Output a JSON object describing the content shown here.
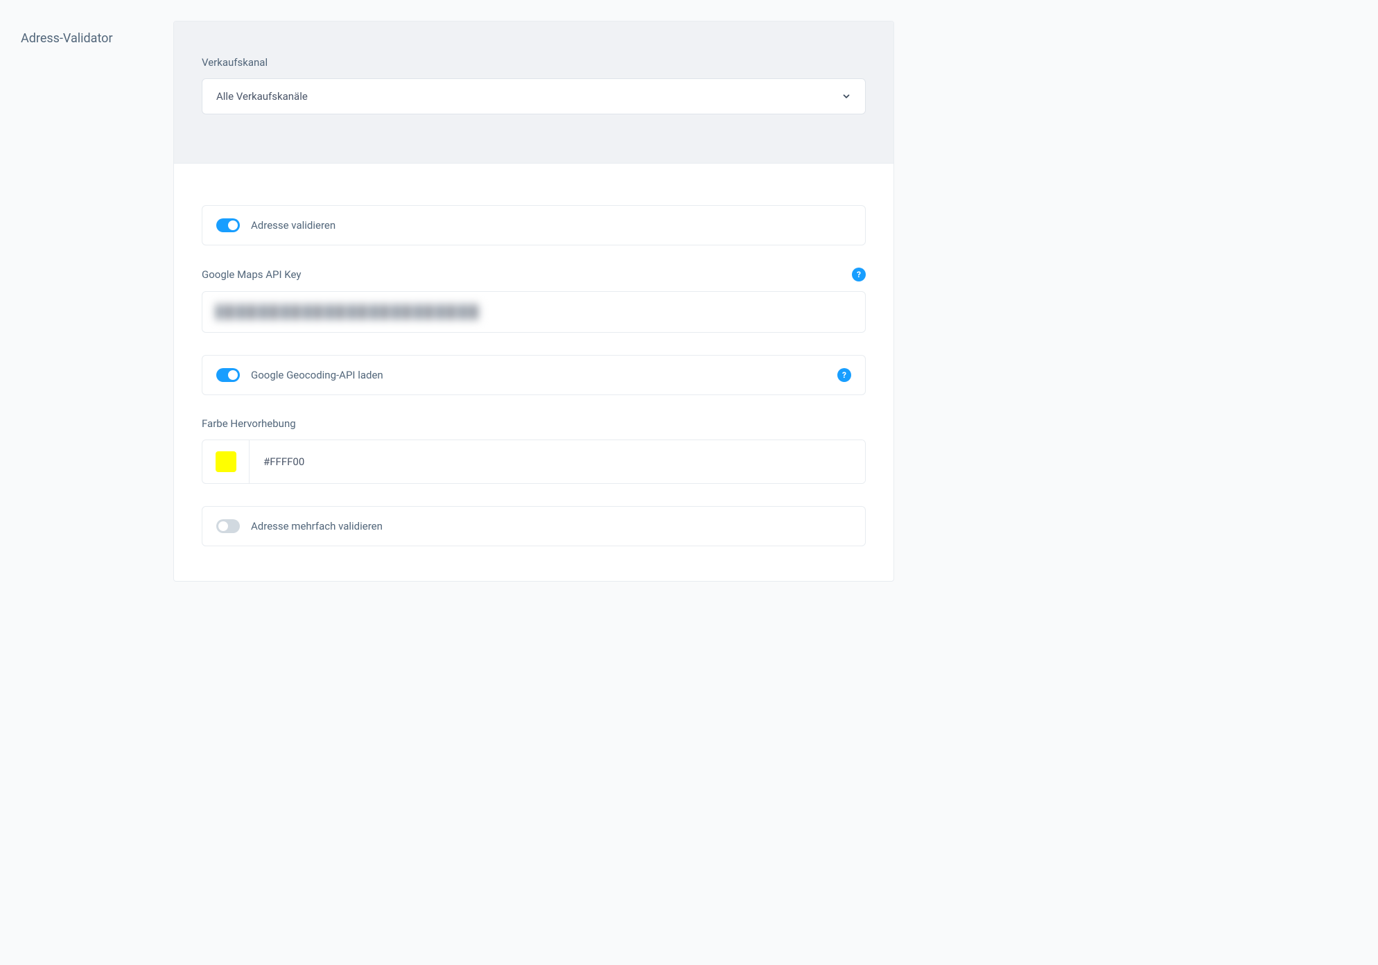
{
  "title": "Adress-Validator",
  "header": {
    "channel_label": "Verkaufskanal",
    "channel_selected": "Alle Verkaufskanäle"
  },
  "settings": {
    "validate_address": {
      "label": "Adresse validieren",
      "enabled": true
    },
    "api_key": {
      "label": "Google Maps API Key",
      "value": "••••••••••••••••••••••••••"
    },
    "load_geocoding": {
      "label": "Google Geocoding-API laden",
      "enabled": true
    },
    "highlight_color": {
      "label": "Farbe Hervorhebung",
      "value": "#FFFF00"
    },
    "validate_multiple": {
      "label": "Adresse mehrfach validieren",
      "enabled": false
    }
  },
  "icons": {
    "help": "?"
  }
}
